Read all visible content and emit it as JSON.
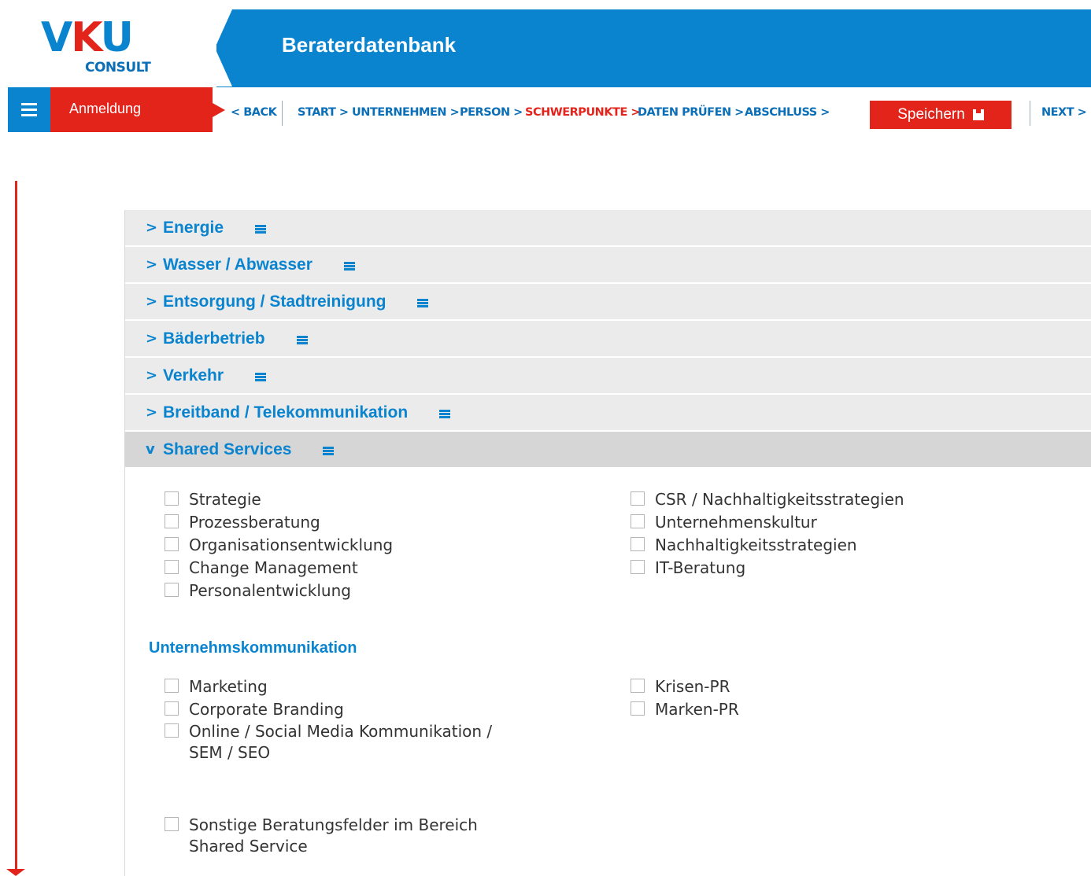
{
  "header": {
    "logo_main_v": "V",
    "logo_main_k": "K",
    "logo_main_u": "U",
    "logo_sub": "CONSULT",
    "title": "Beraterdatenbank"
  },
  "nav": {
    "menu_icon": "hamburger-icon",
    "section": "Anmeldung",
    "back": "< BACK",
    "steps": [
      "START >",
      "UNTERNEHMEN >",
      "PERSON >",
      "SCHWERPUNKTE >",
      "DATEN PRÜFEN >",
      "ABSCHLUSS >"
    ],
    "active_step": "SCHWERPUNKTE >",
    "save": "Speichern",
    "next": "NEXT >"
  },
  "accordion": [
    {
      "label": "Energie",
      "chevron": ">",
      "open": false
    },
    {
      "label": "Wasser / Abwasser",
      "chevron": ">",
      "open": false
    },
    {
      "label": "Entsorgung / Stadtreinigung",
      "chevron": ">",
      "open": false
    },
    {
      "label": "Bäderbetrieb",
      "chevron": ">",
      "open": false
    },
    {
      "label": "Verkehr",
      "chevron": ">",
      "open": false
    },
    {
      "label": "Breitband / Telekommunikation",
      "chevron": ">",
      "open": false
    },
    {
      "label": "Shared Services",
      "chevron": "v",
      "open": true
    }
  ],
  "shared_services": {
    "left": [
      "Strategie",
      "Prozessberatung",
      "Organisationsentwicklung",
      "Change Management",
      "Personalentwicklung"
    ],
    "right": [
      "CSR / Nachhaltigkeitsstrategien",
      "Unternehmenskultur",
      "Nachhaltigkeitsstrategien",
      "IT-Beratung"
    ],
    "comm_title": "Unternehmskommunikation",
    "comm_left": [
      "Marketing",
      "Corporate Branding",
      "Online / Social Media Kommunikation /",
      "SEM / SEO"
    ],
    "comm_right": [
      "Krisen-PR",
      "Marken-PR"
    ],
    "other_line1": "Sonstige Beratungsfelder im Bereich",
    "other_line2": "Shared Service"
  },
  "colors": {
    "brand_blue": "#0a84cf",
    "brand_red": "#e2241b"
  }
}
